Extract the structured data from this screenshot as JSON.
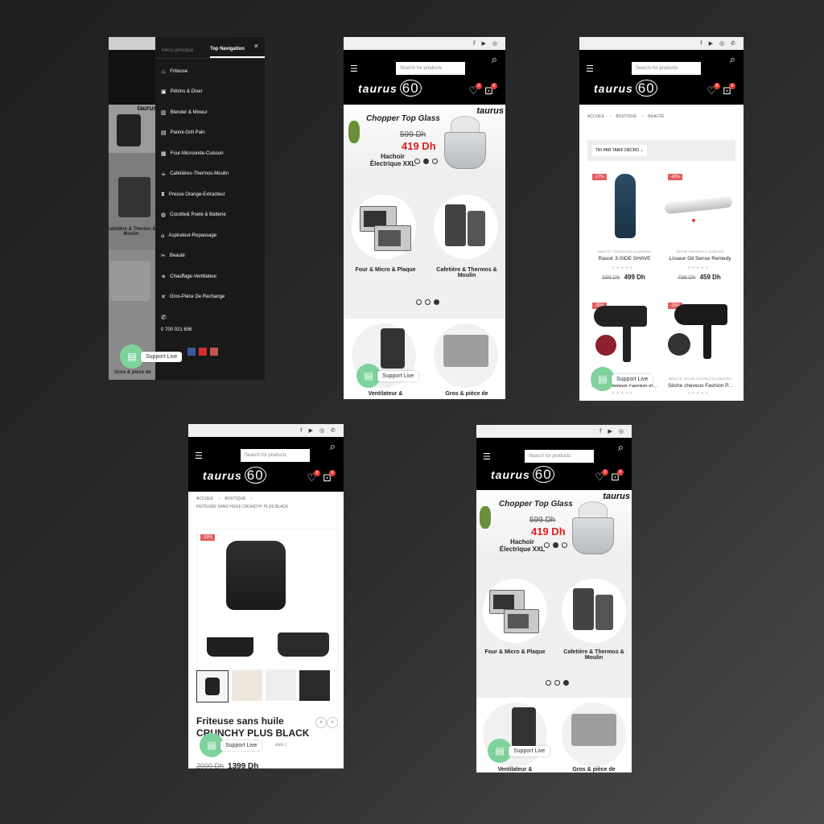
{
  "common": {
    "search_placeholder": "Search for products",
    "brand": "taurus",
    "brand_num": "60",
    "wish_count": "0",
    "cart_count": "0",
    "support_label": "Support Live",
    "social_icons": [
      "f",
      "▶",
      "◎",
      "✆"
    ]
  },
  "banner": {
    "title": "Chopper Top Glass",
    "old_price": "599 Dh",
    "new_price": "419 Dh",
    "subtitle": "Hachoir Électrique XXL",
    "brand": "taurus"
  },
  "categories": {
    "cat1": "Four & Micro & Plaque",
    "cat2": "Cafetière & Thermos & Moulin",
    "cat3": "Ventilateur &",
    "cat4": "Gros & pièce de"
  },
  "menu": {
    "tab1": "Menu principal",
    "tab2": "Top Navigation",
    "close": "×",
    "items": [
      {
        "icon": "♨",
        "label": "Friteuse"
      },
      {
        "icon": "▣",
        "label": "Pétrins & Diver"
      },
      {
        "icon": "▥",
        "label": "Blender & Mixeur"
      },
      {
        "icon": "▤",
        "label": "Panini-Grill Pain"
      },
      {
        "icon": "▦",
        "label": "Four-Microonde-Cuisson"
      },
      {
        "icon": "☕",
        "label": "Cafetières-Thermos-Moulin"
      },
      {
        "icon": "⧗",
        "label": "Presse Orange-Extracteur"
      },
      {
        "icon": "◍",
        "label": "Cocotte& Poele & Batterie"
      },
      {
        "icon": "⌂",
        "label": "Aspirateur-Repassage"
      },
      {
        "icon": "✂",
        "label": "Beauté"
      },
      {
        "icon": "☀",
        "label": "Chauffage-Ventilateur"
      },
      {
        "icon": "✕",
        "label": "Gros-Piéce De Rechange"
      }
    ],
    "phone_icon": "✆",
    "phone": "0 700 021 606",
    "bg_cafetiere": "Cafetière & Thermo & Moulin",
    "bg_gros": "Gros & pièce de",
    "bg_brand": "taurus"
  },
  "shop": {
    "breadcrumb": [
      "ACCUEIL",
      "BOUTIQUE",
      "BEAUTÉ"
    ],
    "sort_label": "TRI PAR TARIF DÉCRO",
    "products": [
      {
        "discount": "-17%",
        "category": "BEAUTÉ, TONDEUSES & RASOIRS",
        "name": "Rasoir 3-SIDE SHAVE",
        "old": "599 Dh",
        "price": "499 Dh"
      },
      {
        "discount": "-43%",
        "category": "SÈCHE CHEVEUX & LISSEURS",
        "name": "Lisseur Oil Sense Remedy",
        "old": "799 Dh",
        "price": "459 Dh"
      },
      {
        "discount": "-20%",
        "category": "",
        "name": "Sèche cheveux Fashion In...",
        "old": "",
        "price": ""
      },
      {
        "discount": "-16%",
        "category": "BEAUTÉ, SÈCHE CHEVEUX & LISSEURS",
        "name": "Sèche cheveux Fashion P...",
        "old": "",
        "price": ""
      }
    ]
  },
  "product": {
    "breadcrumb": [
      "ACCUEIL",
      "BOUTIQUE"
    ],
    "breadcrumb2": "FRITEUSE SANS HUILE CRUNCHY PLUS BLACK",
    "discount": "-30%",
    "title_line1": "Friteuse sans huile",
    "title_line2": "CRUNCHY PLUS BLACK",
    "reviews": "avis )",
    "old_price": "2000 Dh",
    "price": "1399 Dh",
    "prev": "‹",
    "next": "›"
  }
}
